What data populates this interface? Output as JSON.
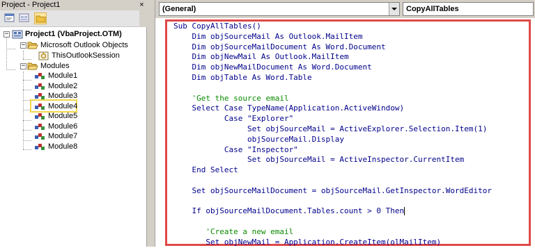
{
  "project_pane": {
    "title": "Project - Project1",
    "close_glyph": "×",
    "toolbar": [
      {
        "name": "view-code-icon"
      },
      {
        "name": "view-object-icon"
      },
      {
        "name": "toggle-folders-icon",
        "active": true
      }
    ],
    "tree": {
      "project": "Project1 (VbaProject.OTM)",
      "outlook_objects_folder": "Microsoft Outlook Objects",
      "outlook_session": "ThisOutlookSession",
      "modules_folder": "Modules",
      "modules": [
        "Module1",
        "Module2",
        "Module3",
        "Module4",
        "Module5",
        "Module6",
        "Module7",
        "Module8"
      ],
      "selected_module": "Module4",
      "highlight_color": "#f3d74b"
    }
  },
  "code_window": {
    "object_combo": "(General)",
    "procedure_combo": "CopyAllTables",
    "highlight_color": "#e04848",
    "lines": [
      {
        "text": "Sub CopyAllTables()",
        "kind": "code"
      },
      {
        "text": "    Dim objSourceMail As Outlook.MailItem",
        "kind": "code"
      },
      {
        "text": "    Dim objSourceMailDocument As Word.Document",
        "kind": "code"
      },
      {
        "text": "    Dim objNewMail As Outlook.MailItem",
        "kind": "code"
      },
      {
        "text": "    Dim objNewMailDocument As Word.Document",
        "kind": "code"
      },
      {
        "text": "    Dim objTable As Word.Table",
        "kind": "code"
      },
      {
        "text": "",
        "kind": "blank"
      },
      {
        "text": "    'Get the source email",
        "kind": "comment"
      },
      {
        "text": "    Select Case TypeName(Application.ActiveWindow)",
        "kind": "code"
      },
      {
        "text": "           Case \"Explorer\"",
        "kind": "code"
      },
      {
        "text": "                Set objSourceMail = ActiveExplorer.Selection.Item(1)",
        "kind": "code"
      },
      {
        "text": "                objSourceMail.Display",
        "kind": "code"
      },
      {
        "text": "           Case \"Inspector\"",
        "kind": "code"
      },
      {
        "text": "                Set objSourceMail = ActiveInspector.CurrentItem",
        "kind": "code"
      },
      {
        "text": "    End Select",
        "kind": "code"
      },
      {
        "text": "",
        "kind": "blank"
      },
      {
        "text": "    Set objSourceMailDocument = objSourceMail.GetInspector.WordEditor",
        "kind": "code"
      },
      {
        "text": "",
        "kind": "blank"
      },
      {
        "text": "    If objSourceMailDocument.Tables.count > 0 Then",
        "kind": "code",
        "caret": true
      },
      {
        "text": "",
        "kind": "blank"
      },
      {
        "text": "       'Create a new email",
        "kind": "comment"
      },
      {
        "text": "       Set objNewMail = Application.CreateItem(olMailItem)",
        "kind": "code"
      }
    ],
    "code_color": "#00008b",
    "comment_color": "#0a8a00"
  }
}
